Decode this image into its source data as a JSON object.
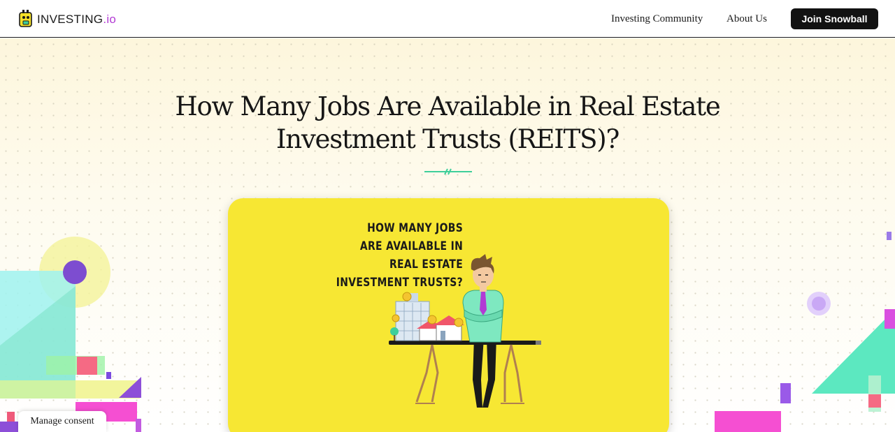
{
  "header": {
    "logo_text": "INVESTING",
    "logo_suffix": ".io",
    "nav": [
      {
        "label": "Investing Community"
      },
      {
        "label": "About Us"
      }
    ],
    "cta_label": "Join Snowball"
  },
  "hero": {
    "title": "How Many Jobs Are Available in Real Estate Investment Trusts (REITS)?",
    "image_caption_lines": [
      "HOW MANY JOBS",
      "ARE AVAILABLE IN",
      "REAL ESTATE",
      "INVESTMENT TRUSTS?"
    ]
  },
  "consent": {
    "label": "Manage consent"
  },
  "colors": {
    "accent_green": "#3ecf9a",
    "card_yellow": "#f7e733",
    "brand_purple": "#b23bd4",
    "button_dark": "#121212"
  },
  "icons": [
    "investing-logo-icon",
    "divider-icon",
    "character-illustration",
    "decorative-shapes"
  ]
}
